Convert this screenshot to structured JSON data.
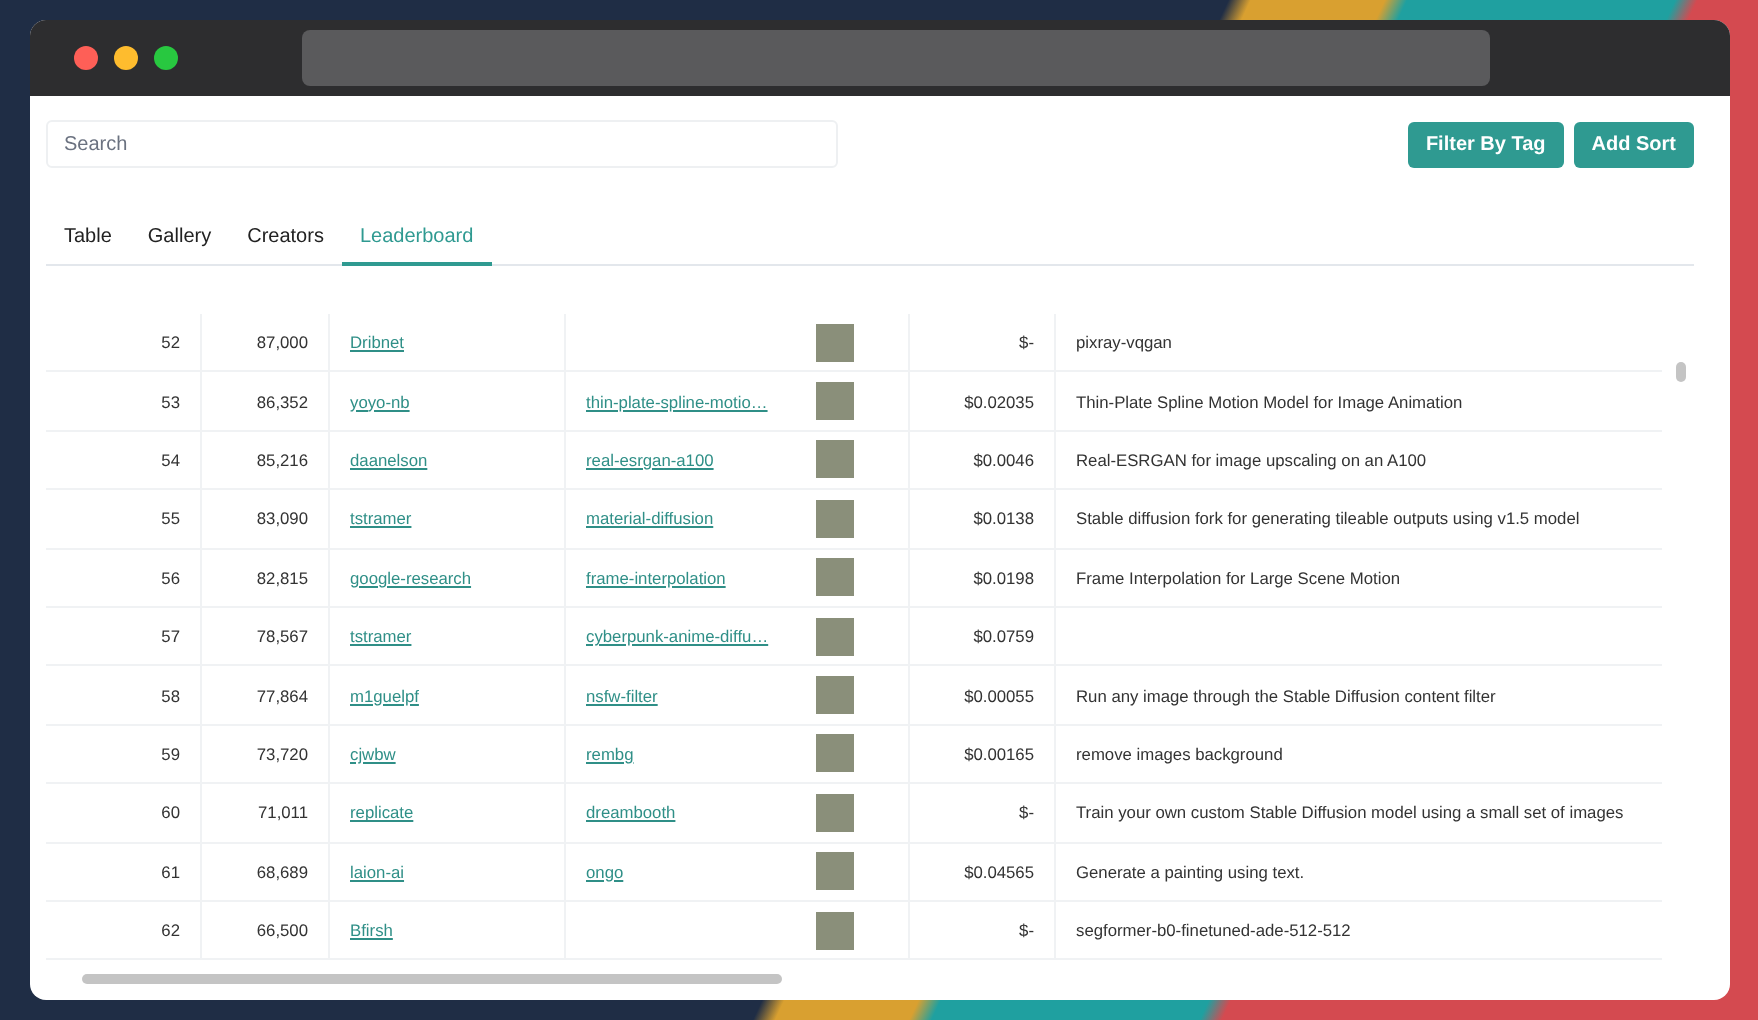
{
  "search": {
    "placeholder": "Search"
  },
  "buttons": [
    "Filter By Tag",
    "Add Sort"
  ],
  "tabs": [
    {
      "label": "Table",
      "selected": false
    },
    {
      "label": "Gallery",
      "selected": false
    },
    {
      "label": "Creators",
      "selected": false
    },
    {
      "label": "Leaderboard",
      "selected": true
    }
  ],
  "table": {
    "rows": [
      {
        "rank": "52",
        "runs": "87,000",
        "owner": "Dribnet",
        "cost": "$-",
        "description": "pixray-vqgan"
      },
      {
        "rank": "53",
        "runs": "86,352",
        "owner": "yoyo-nb",
        "model": "thin-plate-spline-motio…",
        "cost": "$0.02035",
        "description": "Thin-Plate Spline Motion Model for Image Animation"
      },
      {
        "rank": "54",
        "runs": "85,216",
        "owner": "daanelson",
        "model": "real-esrgan-a100",
        "cost": "$0.0046",
        "description": "Real-ESRGAN for image upscaling on an A100"
      },
      {
        "rank": "55",
        "runs": "83,090",
        "owner": "tstramer",
        "model": "material-diffusion",
        "cost": "$0.0138",
        "description": "Stable diffusion fork for generating tileable outputs using v1.5 model"
      },
      {
        "rank": "56",
        "runs": "82,815",
        "owner": "google-research",
        "model": "frame-interpolation",
        "cost": "$0.0198",
        "description": "Frame Interpolation for Large Scene Motion"
      },
      {
        "rank": "57",
        "runs": "78,567",
        "owner": "tstramer",
        "model": "cyberpunk-anime-diffu…",
        "cost": "$0.0759"
      },
      {
        "rank": "58",
        "runs": "77,864",
        "owner": "m1guelpf",
        "model": "nsfw-filter",
        "cost": "$0.00055",
        "description": "Run any image through the Stable Diffusion content filter"
      },
      {
        "rank": "59",
        "runs": "73,720",
        "owner": "cjwbw",
        "model": "rembg",
        "cost": "$0.00165",
        "description": "remove images background"
      },
      {
        "rank": "60",
        "runs": "71,011",
        "owner": "replicate",
        "model": "dreambooth",
        "cost": "$-",
        "description": "Train your own custom Stable Diffusion model using a small set of images"
      },
      {
        "rank": "61",
        "runs": "68,689",
        "owner": "laion-ai",
        "model": "ongo",
        "cost": "$0.04565",
        "description": "Generate a painting using text."
      },
      {
        "rank": "62",
        "runs": "66,500",
        "owner": "Bfirsh",
        "cost": "$-",
        "description": "segformer-b0-finetuned-ade-512-512"
      }
    ]
  }
}
